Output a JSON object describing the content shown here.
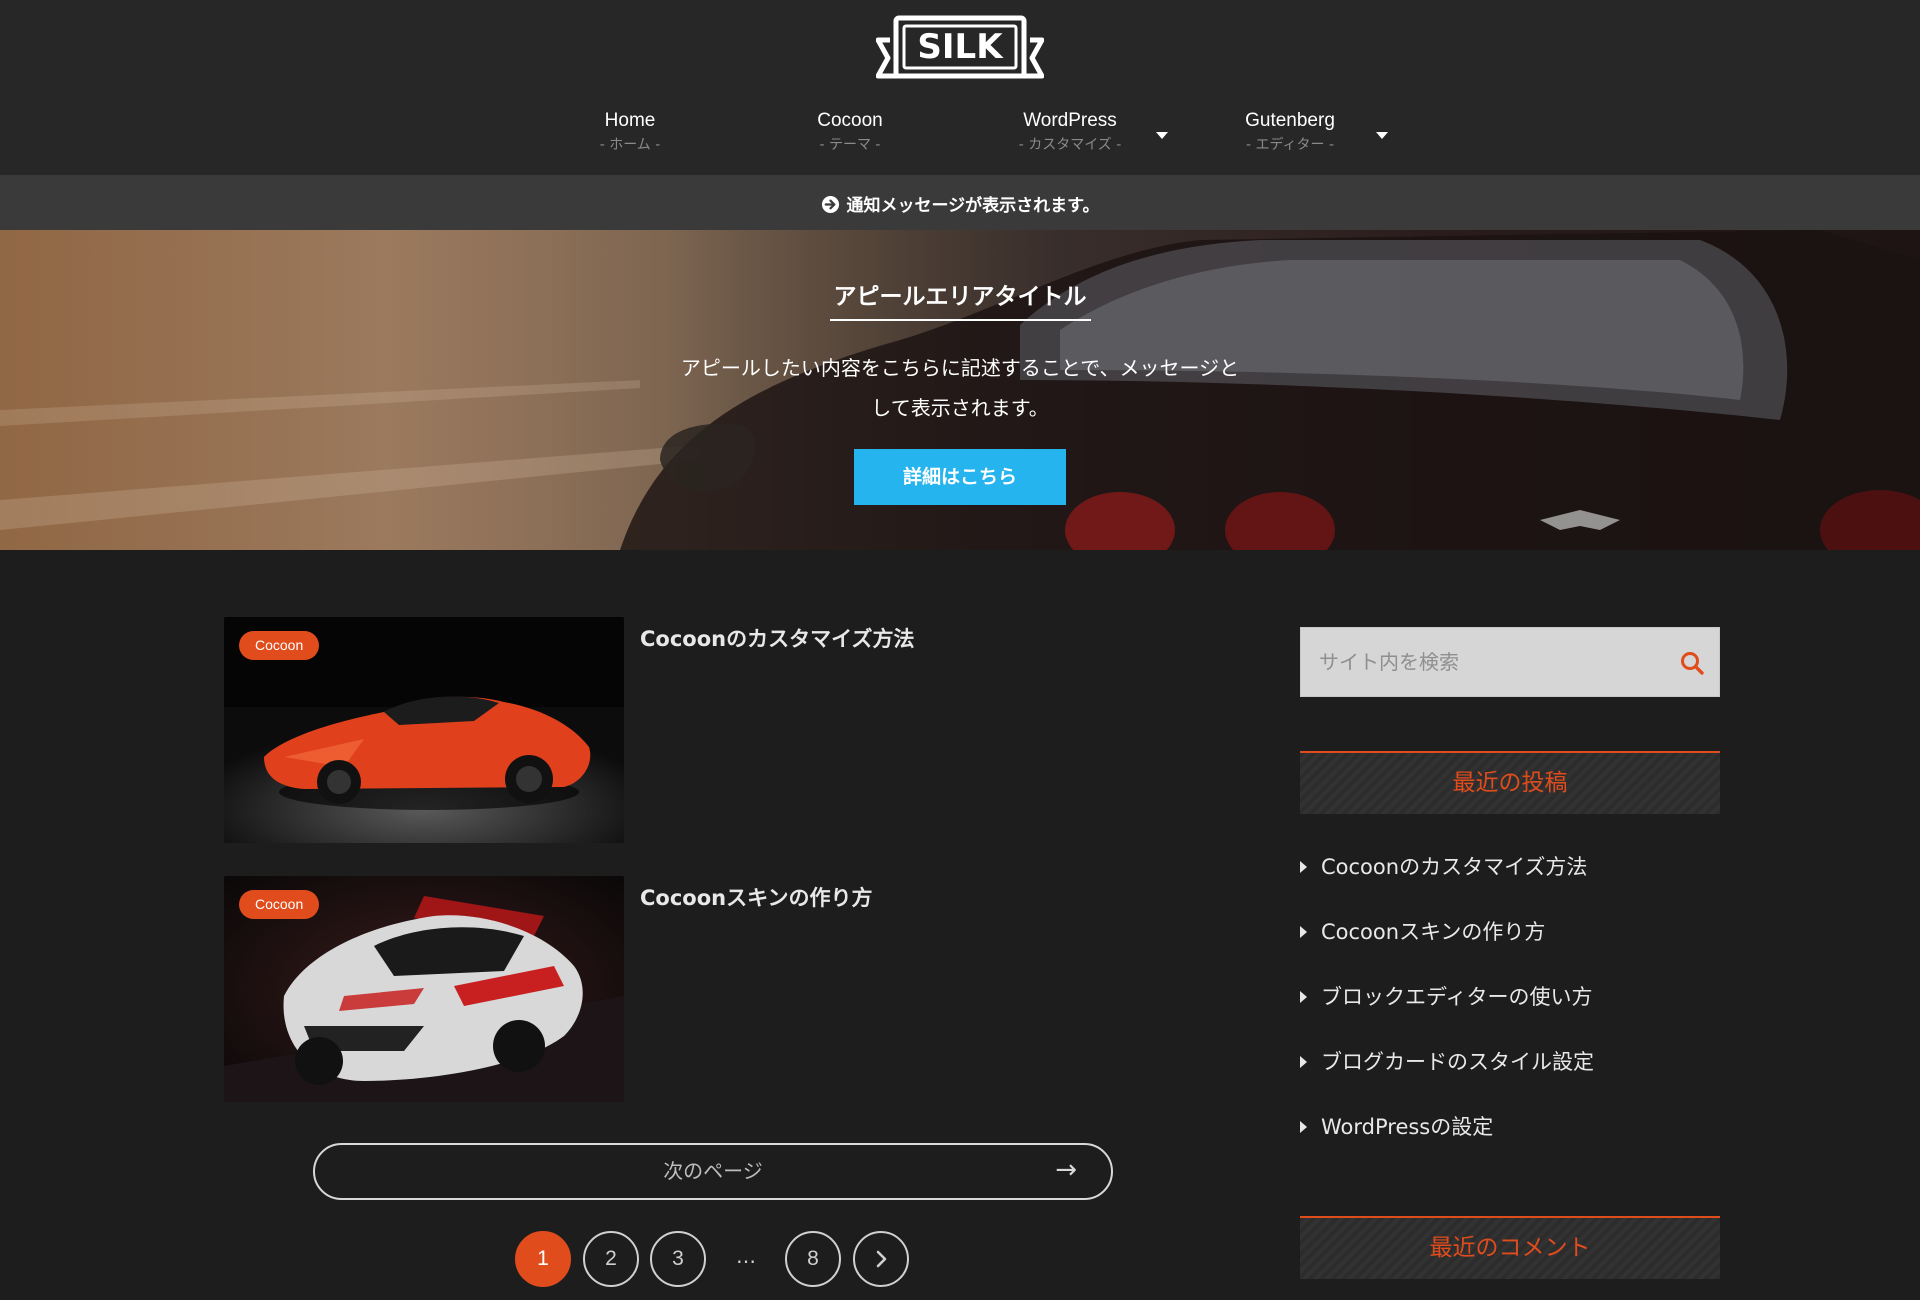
{
  "header": {
    "logo_text": "SILK",
    "nav": [
      {
        "label": "Home",
        "sub": "- ホーム -",
        "has_dropdown": false
      },
      {
        "label": "Cocoon",
        "sub": "- テーマ -",
        "has_dropdown": false
      },
      {
        "label": "WordPress",
        "sub": "- カスタマイズ -",
        "has_dropdown": true
      },
      {
        "label": "Gutenberg",
        "sub": "- エディター -",
        "has_dropdown": true
      }
    ]
  },
  "notice": {
    "icon": "arrow-circle-right-icon",
    "text": "通知メッセージが表示されます。"
  },
  "appeal": {
    "title": "アピールエリアタイトル",
    "message_line1": "アピールしたい内容をこちらに記述することで、メッセージと",
    "message_line2": "して表示されます。",
    "button_label": "詳細はこちら",
    "button_color": "#25b4ee"
  },
  "posts": [
    {
      "category": "Cocoon",
      "title": "Cocoonのカスタマイズ方法",
      "thumb": "red-sports-car-image"
    },
    {
      "category": "Cocoon",
      "title": "Cocoonスキンの作り方",
      "thumb": "white-red-race-car-image"
    }
  ],
  "pagination": {
    "next_label": "次のページ",
    "next_arrow": "→",
    "pages": [
      "1",
      "2",
      "3",
      "…",
      "8"
    ],
    "current": "1",
    "next_icon": "chevron-right-icon"
  },
  "sidebar": {
    "search_placeholder": "サイト内を検索",
    "search_icon": "search-icon",
    "recent_posts_title": "最近の投稿",
    "recent_posts": [
      "Cocoonのカスタマイズ方法",
      "Cocoonスキンの作り方",
      "ブロックエディターの使い方",
      "ブログカードのスタイル設定",
      "WordPressの設定"
    ],
    "recent_comments_title": "最近のコメント"
  },
  "colors": {
    "accent": "#e04c1c",
    "background": "#1d1d1d",
    "header_bg": "#272727",
    "notice_bg": "#3a3a3a"
  }
}
